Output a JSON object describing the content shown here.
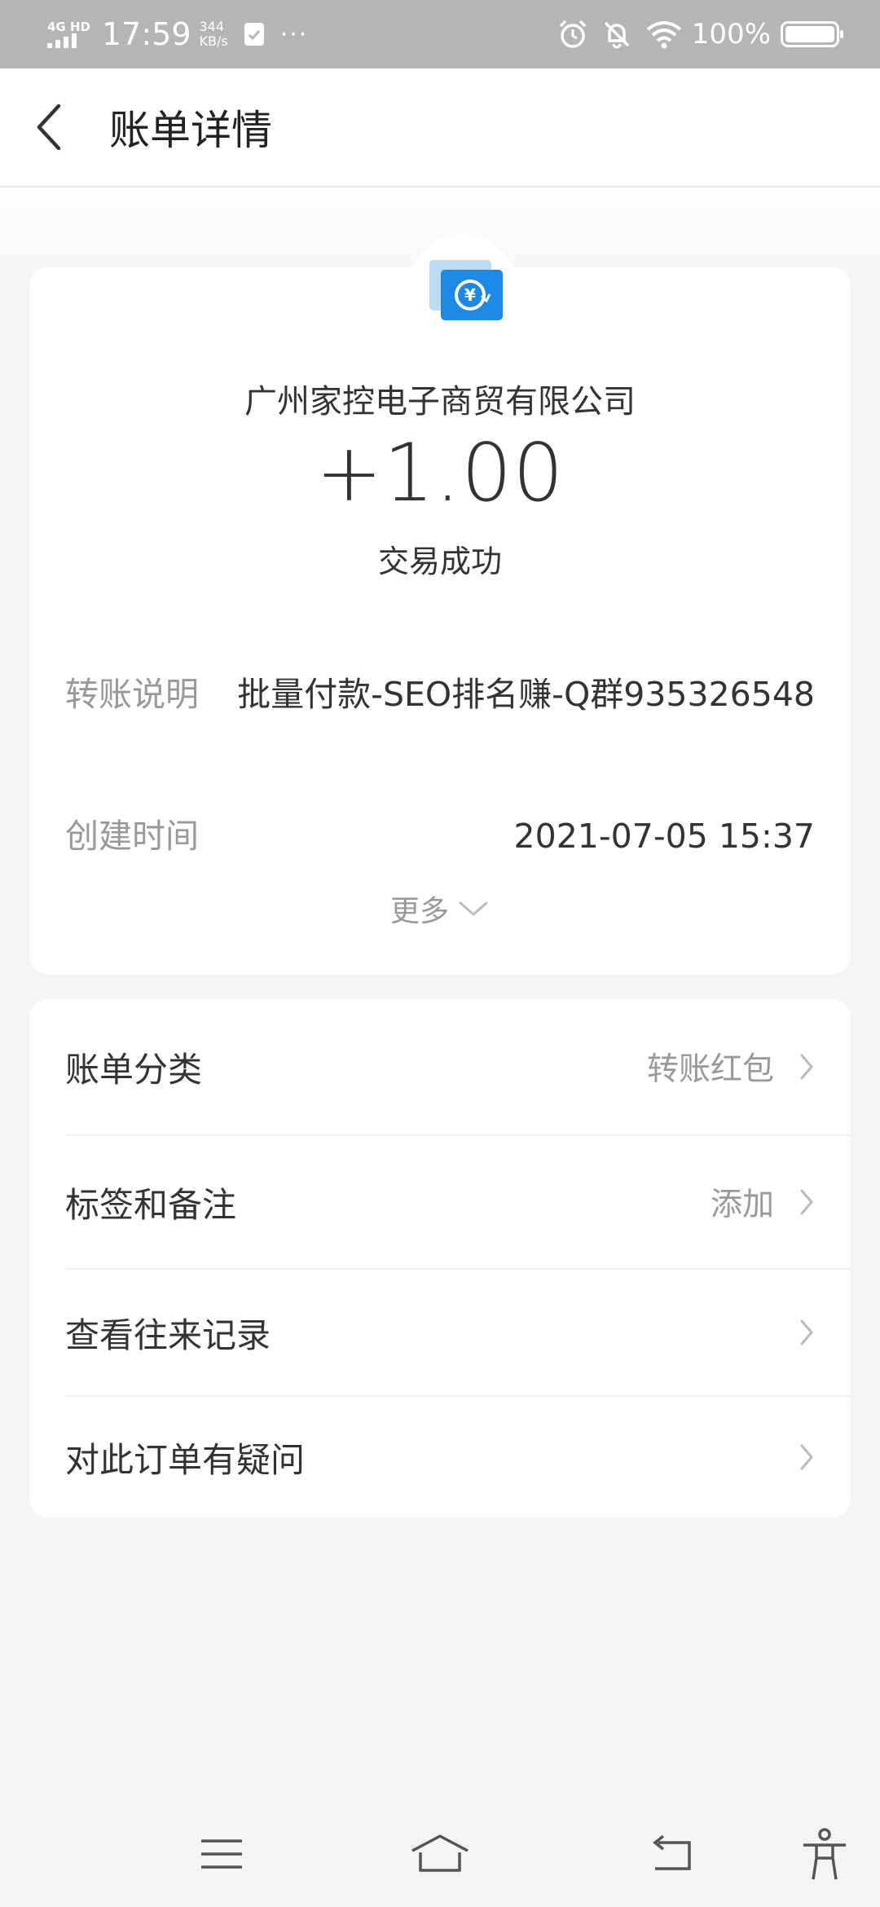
{
  "status_bar": {
    "network": "4G HD",
    "time": "17:59",
    "speed_value": "344",
    "speed_unit": "KB/s",
    "more": "···",
    "battery": "100%"
  },
  "nav": {
    "title": "账单详情"
  },
  "summary": {
    "merchant": "广州家控电子商贸有限公司",
    "amount": "+1.00",
    "status": "交易成功",
    "details": [
      {
        "label": "转账说明",
        "value": "批量付款-SEO排名赚-Q群935326548"
      },
      {
        "label": "创建时间",
        "value": "2021-07-05 15:37"
      }
    ],
    "more_label": "更多"
  },
  "list": [
    {
      "label": "账单分类",
      "value": "转账红包"
    },
    {
      "label": "标签和备注",
      "value": "添加"
    },
    {
      "label": "查看往来记录",
      "value": ""
    },
    {
      "label": "对此订单有疑问",
      "value": ""
    }
  ],
  "colors": {
    "accent_blue": "#1e88e5",
    "light_blue": "#bcdcf5",
    "status_bar_bg": "#b5b5b5"
  }
}
